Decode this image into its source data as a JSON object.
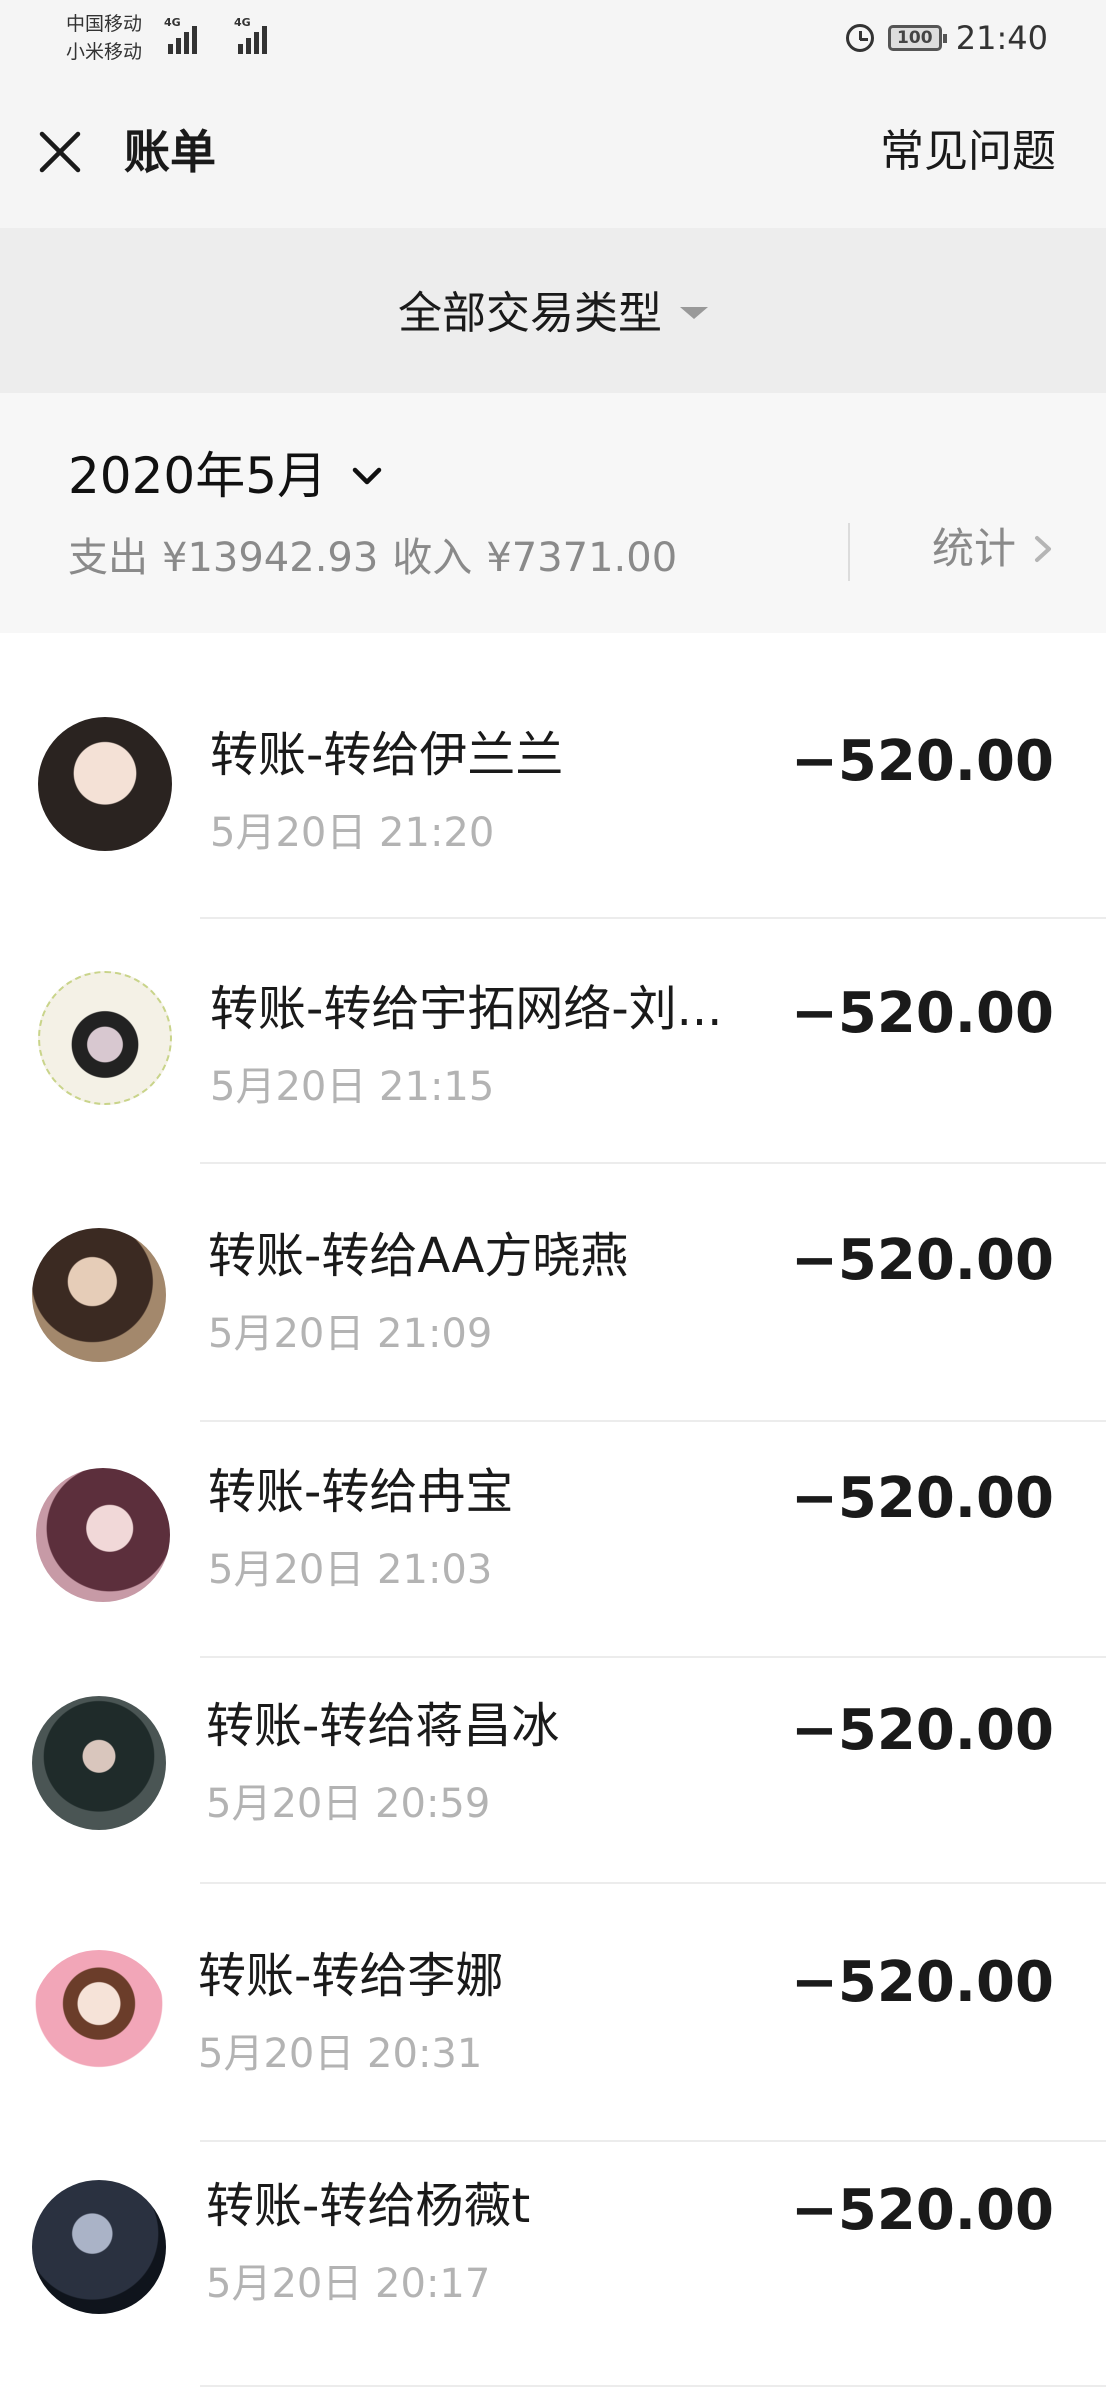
{
  "status_bar": {
    "carrier_1": "中国移动",
    "carrier_2": "小米移动",
    "network_1": "4G",
    "network_2": "4G",
    "battery": "100",
    "time": "21:40"
  },
  "header": {
    "title": "账单",
    "faq_label": "常见问题"
  },
  "filter": {
    "label": "全部交易类型"
  },
  "month": {
    "label": "2020年5月",
    "expense_label": "支出",
    "expense_value": "¥13942.93",
    "income_label": "收入",
    "income_value": "¥7371.00",
    "stats_label": "统计"
  },
  "transactions": [
    {
      "title": "转账-转给伊兰兰",
      "time": "5月20日 21:20",
      "amount": "−520.00",
      "avatar": "photo-avatar"
    },
    {
      "title": "转账-转给宇拓网络-刘...",
      "time": "5月20日 21:15",
      "amount": "−520.00",
      "avatar": "witch-cartoon-avatar"
    },
    {
      "title": "转账-转给AA方晓燕",
      "time": "5月20日 21:09",
      "amount": "−520.00",
      "avatar": "photo-avatar"
    },
    {
      "title": "转账-转给冉宝",
      "time": "5月20日 21:03",
      "amount": "−520.00",
      "avatar": "photo-avatar"
    },
    {
      "title": "转账-转给蒋昌冰",
      "time": "5月20日 20:59",
      "amount": "−520.00",
      "avatar": "photo-avatar"
    },
    {
      "title": "转账-转给李娜",
      "time": "5月20日 20:31",
      "amount": "−520.00",
      "avatar": "cat-cartoon-avatar"
    },
    {
      "title": "转账-转给杨薇t",
      "time": "5月20日 20:17",
      "amount": "−520.00",
      "avatar": "photo-avatar"
    }
  ]
}
